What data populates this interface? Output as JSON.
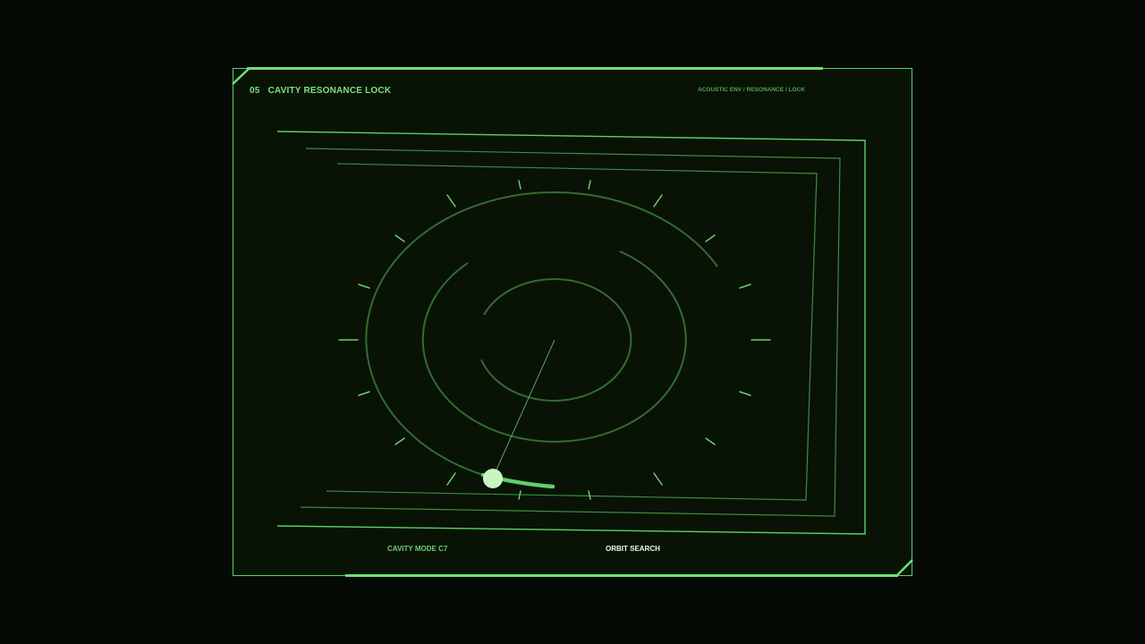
{
  "header": {
    "number": "05",
    "title": "CAVITY RESONANCE LOCK",
    "breadcrumb": "ACOUSTIC ENV / RESONANCE / LOCK"
  },
  "footer": {
    "mode_label": "CAVITY MODE C7",
    "action_label": "ORBIT SEARCH"
  },
  "colors": {
    "background": "#050b04",
    "panel": "#081306",
    "accent": "#5fcf66",
    "dim": "#3c7a3a",
    "highlight": "#c9f5c1"
  }
}
